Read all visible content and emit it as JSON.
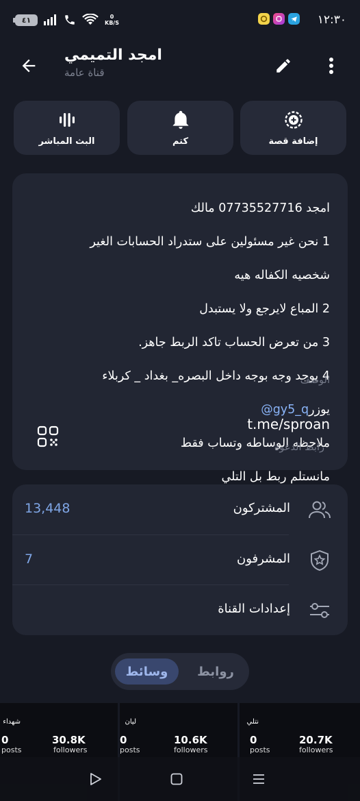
{
  "status_bar": {
    "time": "١٢:٣٠",
    "battery": "٤١",
    "speed_value": "0",
    "speed_unit": "KB/S"
  },
  "header": {
    "title": "امجد التميمي",
    "subtitle": "قناة عامة"
  },
  "actions": [
    {
      "label": "إضافة قصة",
      "icon": "add-story-icon"
    },
    {
      "label": "كتم",
      "icon": "bell-icon"
    },
    {
      "label": "البث المباشر",
      "icon": "live-stream-icon"
    }
  ],
  "info": {
    "description_lines": [
      "امجد 07735527716 مالك",
      "1 نحن غير مسئولين على ستدراد الحسابات الغير",
      "شخصيه الكفاله هيه",
      "2 المباع لايرجع ولا يستبدل",
      "3 من تعرض الحساب تاكد الربط جاهز.",
      "4 يوجد وجه بوجه داخل  البصره_ بغداد _ كربلاء",
      "ملاحظه الوساطه وتساب فقط",
      "مانستلم ربط بل التلي"
    ],
    "username_prefix": "يوزر",
    "username": "@gy5_q",
    "description_label": "الوصف",
    "invite_link": "t.me/sproan",
    "invite_label": "رابط الدعوة"
  },
  "stats": {
    "subscribers_label": "المشتركون",
    "subscribers_value": "13,448",
    "admins_label": "المشرفون",
    "admins_value": "7",
    "settings_label": "إعدادات القناة"
  },
  "tabs": {
    "media": "وسائط",
    "links": "روابط"
  },
  "media_cells": [
    {
      "name": "شهداء",
      "posts": "0",
      "posts_label": "posts",
      "followers": "30.8K",
      "followers_label": "followers"
    },
    {
      "name": "ليان",
      "posts": "0",
      "posts_label": "posts",
      "followers": "10.6K",
      "followers_label": "followers"
    },
    {
      "name": "نتلي",
      "posts": "0",
      "posts_label": "posts",
      "followers": "20.7K",
      "followers_label": "followers"
    }
  ],
  "colors": {
    "background": "#171a24",
    "card": "#222633",
    "accent_blue": "#7fa6e6",
    "link_blue": "#8ab4f8"
  }
}
